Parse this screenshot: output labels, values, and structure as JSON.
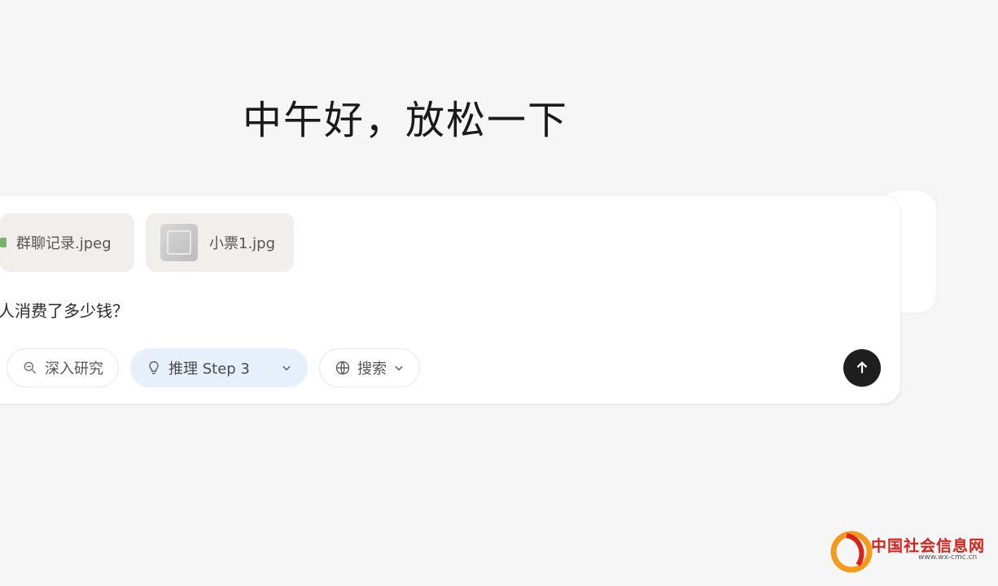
{
  "greeting": "中午好，放松一下",
  "attachments": [
    {
      "name": "群聊记录.jpeg"
    },
    {
      "name": "小票1.jpg"
    }
  ],
  "query_text": "人消费了多少钱？",
  "toolbar": {
    "deep_research": "深入研究",
    "reasoning_label": "推理 Step 3",
    "search_label": "搜索"
  },
  "watermark": {
    "name": "中国社会信息网",
    "url": "www.wx-cmc.cn"
  },
  "icons": {
    "deep_research": "search-document-icon",
    "reasoning": "lightbulb-icon",
    "search": "globe-icon",
    "send": "arrow-up-icon",
    "dropdown": "chevron-down-icon"
  },
  "colors": {
    "background": "#f6f6f6",
    "selected_pill": "#e6f0fb",
    "send_button": "#1f1f1f",
    "watermark": "#d9211c"
  }
}
